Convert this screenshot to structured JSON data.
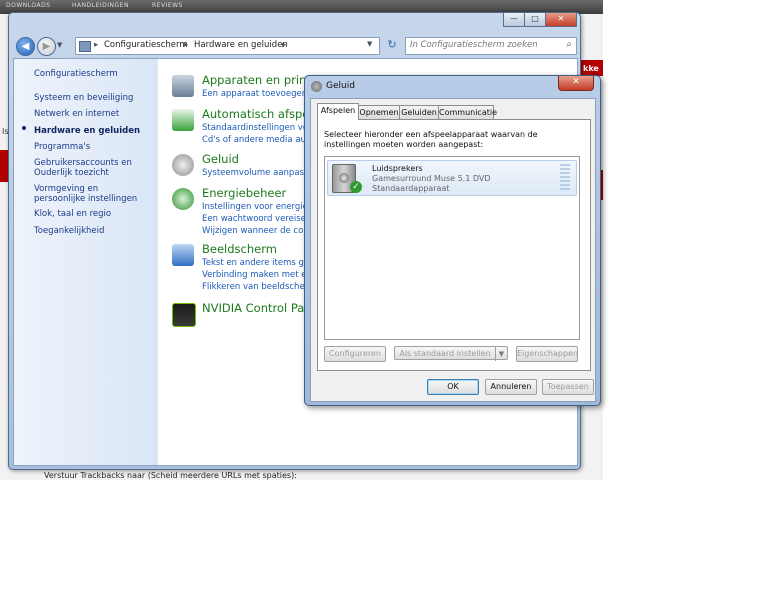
{
  "background_page": {
    "tabs": [
      "DOWNLOADS",
      "HANDLEIDINGEN",
      "REVIEWS"
    ],
    "right_text": "kke",
    "bottom_text": "Verstuur Trackbacks naar (Scheid meerdere URLs met spaties):",
    "left_text": "Is"
  },
  "control_panel": {
    "window_buttons": {
      "minimize": "—",
      "maximize": "□",
      "close": "✕"
    },
    "address": {
      "root": "Configuratiescherm",
      "current": "Hardware en geluiden",
      "separator": "▸"
    },
    "search_placeholder": "In Configuratiescherm zoeken",
    "sidebar": {
      "items": [
        {
          "label": "Configuratiescherm"
        },
        {
          "label": "Systeem en beveiliging"
        },
        {
          "label": "Netwerk en internet"
        },
        {
          "label": "Hardware en geluiden"
        },
        {
          "label": "Programma's"
        },
        {
          "label": "Gebruikersaccounts en Ouderlijk toezicht"
        },
        {
          "label": "Vormgeving en persoonlijke instellingen"
        },
        {
          "label": "Klok, taal en regio"
        },
        {
          "label": "Toegankelijkheid"
        }
      ]
    },
    "categories": [
      {
        "title": "Apparaten en printers",
        "links": [
          "Een apparaat toevoegen"
        ]
      },
      {
        "title": "Automatisch afspelen",
        "links": [
          "Standaardinstellingen voor media of apparaten wijzigen",
          "Cd's of andere media automatisch afspelen"
        ]
      },
      {
        "title": "Geluid",
        "links": [
          "Systeemvolume aanpassen"
        ]
      },
      {
        "title": "Energiebeheer",
        "links": [
          "Instellingen voor energiebesparing wijzigen",
          "Een wachtwoord vereisen als de computer uit de slaapstand komt",
          "Wijzigen wanneer de computer in slaapstand gaat"
        ]
      },
      {
        "title": "Beeldscherm",
        "links": [
          "Tekst en andere items groter of kleiner maken",
          "Verbinding maken met een externe monitor",
          "Flikkeren van beeldscherm verminderen"
        ]
      },
      {
        "title": "NVIDIA Control Panel",
        "links": []
      }
    ],
    "icon_colors": {
      "printers": "#6b7f95",
      "autoplay": "#3aa33a",
      "sound": "#8d8d8d",
      "power": "#2d8f2d",
      "display": "#2f6fc4",
      "nvidia": "#76b900"
    }
  },
  "sound_dialog": {
    "title": "Geluid",
    "close_label": "✕",
    "tabs": [
      "Afspelen",
      "Opnemen",
      "Geluiden",
      "Communicatie"
    ],
    "instruction": "Selecteer hieronder een afspeelapparaat waarvan de instellingen moeten worden aangepast:",
    "device": {
      "name": "Luidsprekers",
      "description": "Gamesurround Muse 5.1 DVD",
      "status": "Standaardapparaat"
    },
    "buttons": {
      "configure": "Configureren",
      "set_default": "Als standaard instellen",
      "properties": "Eigenschappen",
      "ok": "OK",
      "cancel": "Annuleren",
      "apply": "Toepassen"
    }
  }
}
